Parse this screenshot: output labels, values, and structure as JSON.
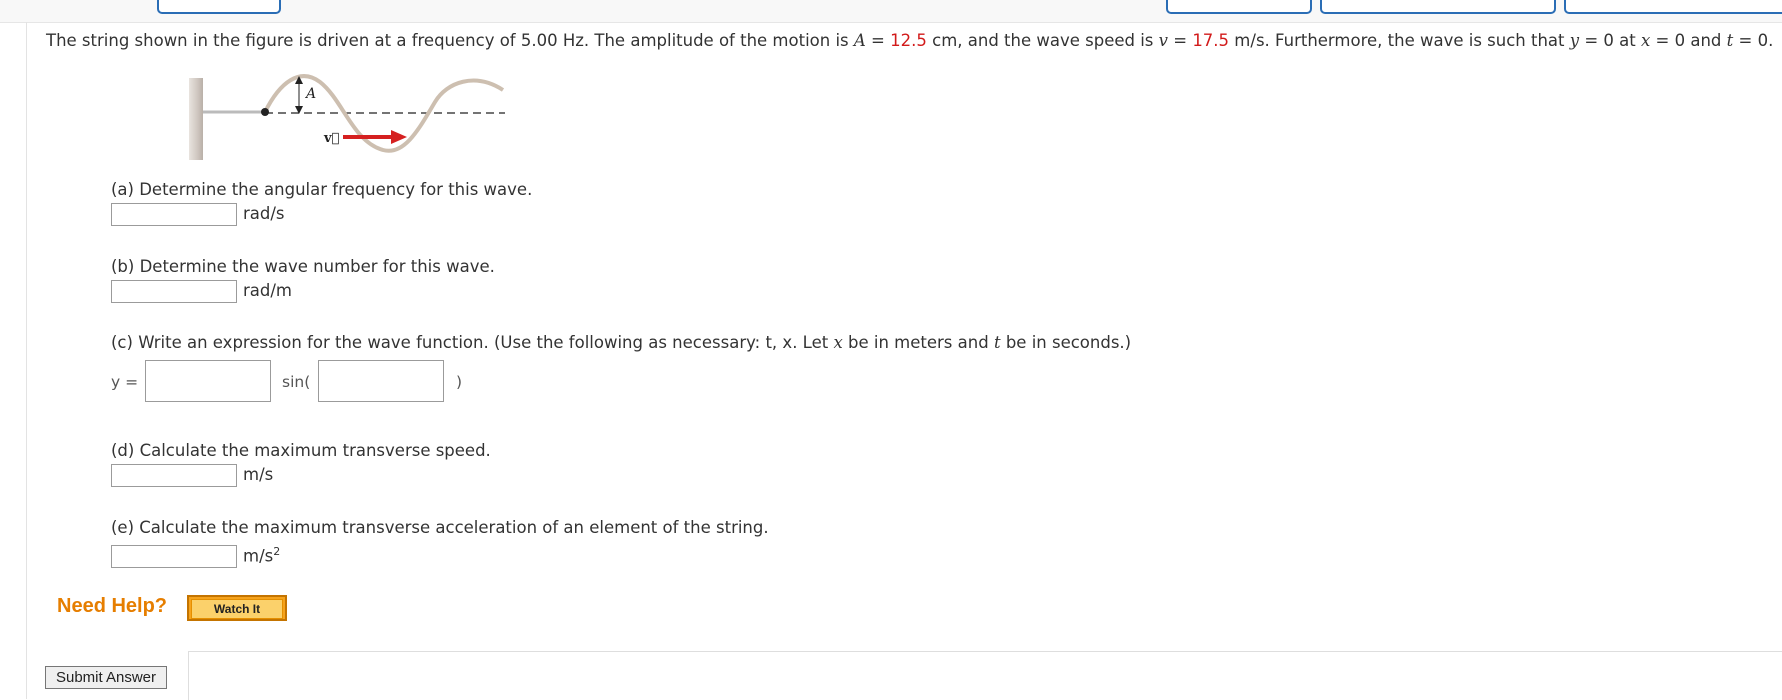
{
  "problem": {
    "part1": "The string shown in the figure is driven at a frequency of 5.00 Hz. The amplitude of the motion is ",
    "A_var": "A",
    "part2": " = ",
    "A_value": "12.5",
    "part3": " cm, and the wave speed is ",
    "v_var": "v",
    "part4": " = ",
    "v_value": "17.5",
    "part5": " m/s. Furthermore, the wave is such that ",
    "y_var": "y",
    "part6": " = 0 at ",
    "x_var": "x",
    "part7": " = 0 and ",
    "t_var": "t",
    "part8": " = 0."
  },
  "figure": {
    "amplitude_label": "A",
    "velocity_label": "v⃗"
  },
  "questions": {
    "a": {
      "text": "(a) Determine the angular frequency for this wave.",
      "unit": "rad/s"
    },
    "b": {
      "text": "(b) Determine the wave number for this wave.",
      "unit": "rad/m"
    },
    "c": {
      "text_pre": "(c) Write an expression for the wave function. (Use the following as necessary: t, x. Let ",
      "x_var": "x",
      "text_mid": " be in meters and ",
      "t_var": "t",
      "text_post": " be in seconds.)",
      "y_label": "y =",
      "sin_label": "sin(",
      "close_paren": ")"
    },
    "d": {
      "text": "(d) Calculate the maximum transverse speed.",
      "unit": "m/s"
    },
    "e": {
      "text": "(e) Calculate the maximum transverse acceleration of an element of the string.",
      "unit": "m/s",
      "unit_sup": "2"
    }
  },
  "help": {
    "label": "Need Help?",
    "watch_button": "Watch It"
  },
  "submit_label": "Submit Answer",
  "colors": {
    "highlight": "#d21a1a",
    "help": "#e67e00",
    "button": "#f6a31c"
  }
}
